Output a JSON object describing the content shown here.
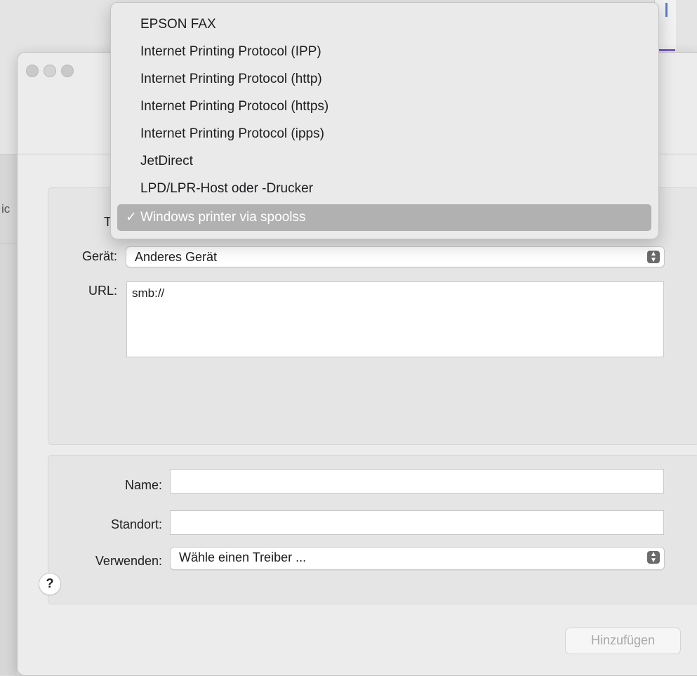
{
  "background": {
    "side_text": "ic"
  },
  "dialog": {
    "type_label": "Typ",
    "device_label": "Gerät:",
    "device_value": "Anderes Gerät",
    "url_label": "URL:",
    "url_value": "smb://",
    "name_label": "Name:",
    "name_value": "",
    "location_label": "Standort:",
    "location_value": "",
    "use_label": "Verwenden:",
    "use_value": "Wähle einen Treiber ...",
    "help_label": "?",
    "add_label": "Hinzufügen",
    "add_enabled": false
  },
  "type_menu": {
    "selected": "Windows printer via spoolss",
    "checkmark": "✓",
    "items": [
      "EPSON FAX",
      "Internet Printing Protocol (IPP)",
      "Internet Printing Protocol (http)",
      "Internet Printing Protocol (https)",
      "Internet Printing Protocol (ipps)",
      "JetDirect",
      "LPD/LPR-Host oder -Drucker",
      "Windows printer via spoolss"
    ]
  },
  "colors": {
    "menu_selection": "#b1b1b1",
    "stepper": "#6b6b6b",
    "disabled_text": "#a8a8a8"
  },
  "icons": {
    "stepper": "chevron-up-down-icon",
    "checkmark": "checkmark-icon"
  }
}
